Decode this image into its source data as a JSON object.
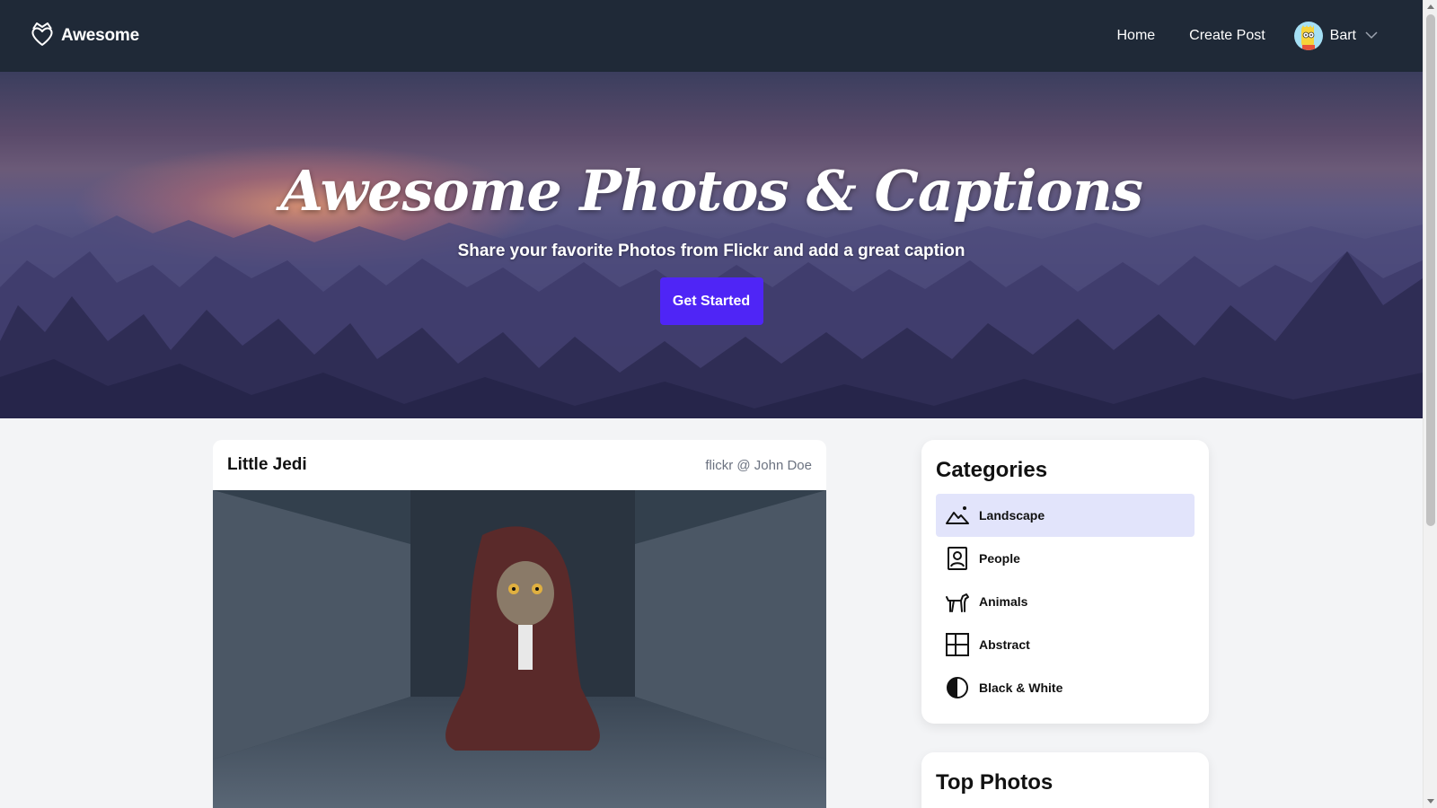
{
  "navbar": {
    "brand": "Awesome",
    "links": [
      {
        "label": "Home"
      },
      {
        "label": "Create Post"
      }
    ],
    "user": {
      "name": "Bart"
    }
  },
  "hero": {
    "title": "Awesome Photos & Captions",
    "subtitle": "Share your favorite Photos from Flickr and add a great caption",
    "cta_label": "Get Started"
  },
  "post": {
    "title": "Little Jedi",
    "credit": "flickr @ John Doe"
  },
  "categories": {
    "heading": "Categories",
    "items": [
      {
        "label": "Landscape",
        "icon": "mountain-icon",
        "active": true
      },
      {
        "label": "People",
        "icon": "person-icon",
        "active": false
      },
      {
        "label": "Animals",
        "icon": "dog-icon",
        "active": false
      },
      {
        "label": "Abstract",
        "icon": "grid-icon",
        "active": false
      },
      {
        "label": "Black & White",
        "icon": "contrast-icon",
        "active": false
      }
    ]
  },
  "top_photos": {
    "heading": "Top Photos"
  },
  "colors": {
    "navbar_bg": "#1f2937",
    "cta_bg": "#4f25f6",
    "active_category_bg": "#e2e4fb",
    "page_bg": "#f3f4f6"
  }
}
